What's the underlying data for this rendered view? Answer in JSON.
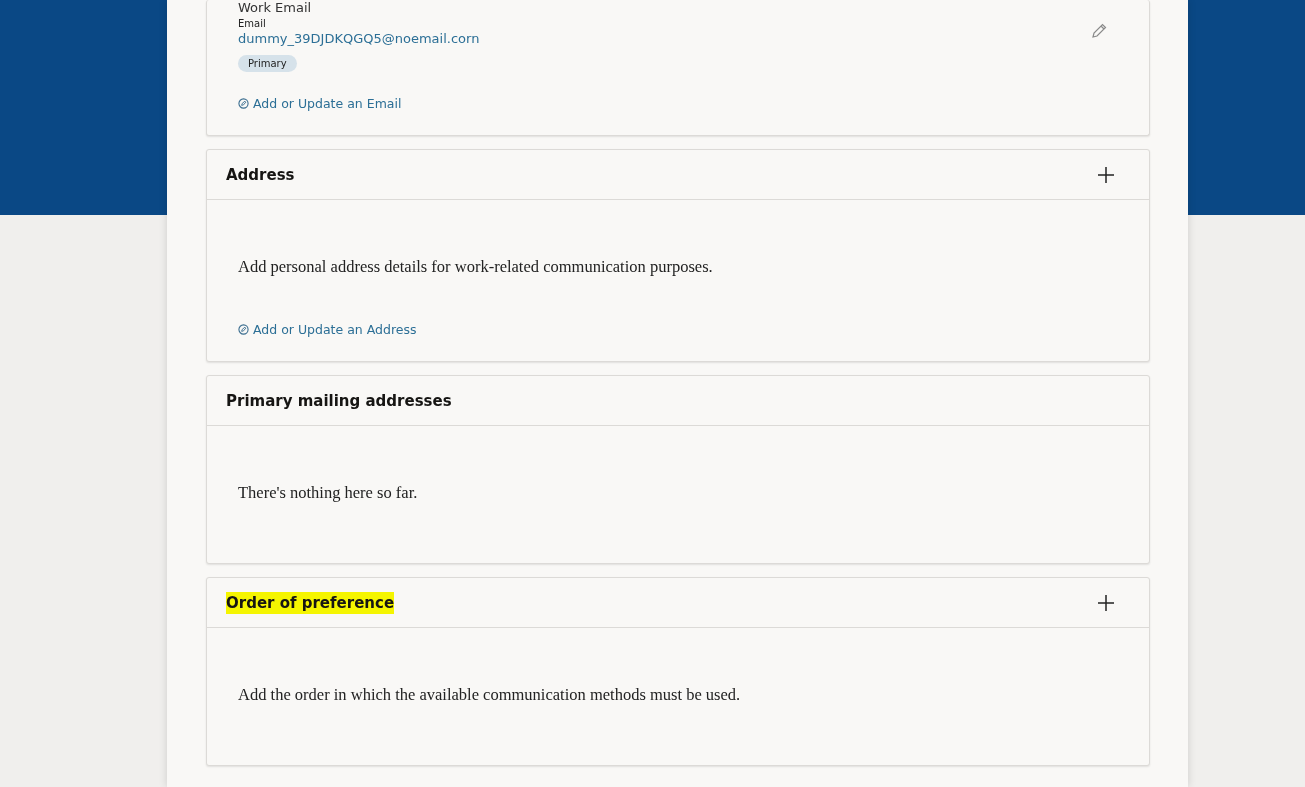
{
  "email_card": {
    "heading": "Work Email",
    "field_label": "Email",
    "value": "dummy_39DJDKQGQ5@noemail.corn",
    "badge": "Primary",
    "link": "Add or Update an Email"
  },
  "sections": [
    {
      "title": "Address",
      "add_button": true,
      "highlighted": false,
      "text": "Add personal address details for work-related communication purposes.",
      "link": "Add or Update an Address"
    },
    {
      "title": "Primary mailing addresses",
      "add_button": false,
      "highlighted": false,
      "text": "There's nothing here so far."
    },
    {
      "title": "Order of preference",
      "add_button": true,
      "highlighted": true,
      "text": "Add the order in which the available communication methods must be used."
    }
  ]
}
